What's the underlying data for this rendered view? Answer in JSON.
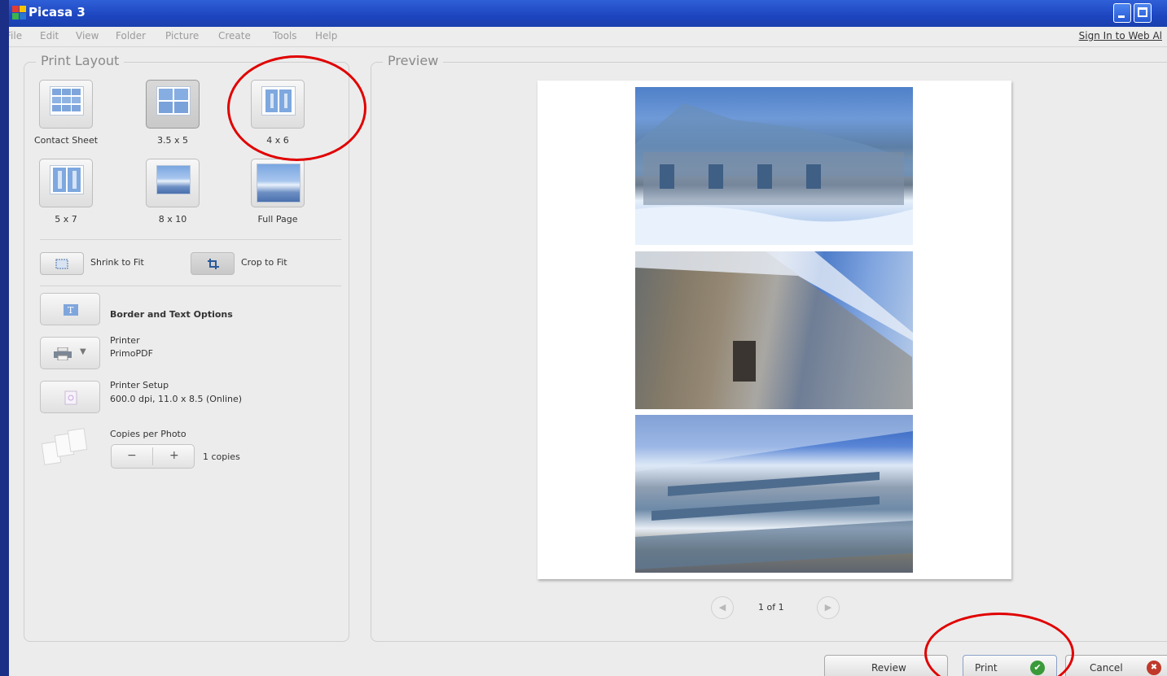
{
  "window": {
    "title": "Picasa 3"
  },
  "menu": {
    "items": [
      "File",
      "Edit",
      "View",
      "Folder",
      "Picture",
      "Create",
      "Tools",
      "Help"
    ],
    "sign_in": "Sign In to Web Al"
  },
  "print_layout": {
    "title": "Print Layout",
    "layouts": [
      {
        "label": "Contact Sheet",
        "icon": "contact-sheet-icon"
      },
      {
        "label": "3.5 x 5",
        "icon": "four-up-icon",
        "selected": true
      },
      {
        "label": "4 x 6",
        "icon": "two-up-icon"
      },
      {
        "label": "5 x 7",
        "icon": "two-up-portrait-icon"
      },
      {
        "label": "8 x 10",
        "icon": "single-landscape-icon"
      },
      {
        "label": "Full Page",
        "icon": "full-page-icon"
      }
    ],
    "shrink_label": "Shrink to Fit",
    "crop_label": "Crop to Fit",
    "border_label": "Border and Text Options",
    "printer_label": "Printer",
    "printer_name": "PrimoPDF",
    "setup_label": "Printer Setup",
    "setup_detail": "600.0 dpi, 11.0 x 8.5 (Online)",
    "copies_label": "Copies per Photo",
    "minus": "−",
    "plus": "+",
    "copies_value": "1 copies"
  },
  "preview": {
    "title": "Preview",
    "pager": "1 of 1",
    "prev_glyph": "◀",
    "next_glyph": "▶"
  },
  "actions": {
    "review": "Review",
    "print": "Print",
    "cancel": "Cancel",
    "print_icon_glyph": "✔",
    "cancel_icon_glyph": "✖"
  },
  "colors": {
    "titlebar": "#1d45bf",
    "highlight_circle": "#e00000",
    "print_check": "#3a9a3a",
    "cancel_x": "#c0392b"
  }
}
